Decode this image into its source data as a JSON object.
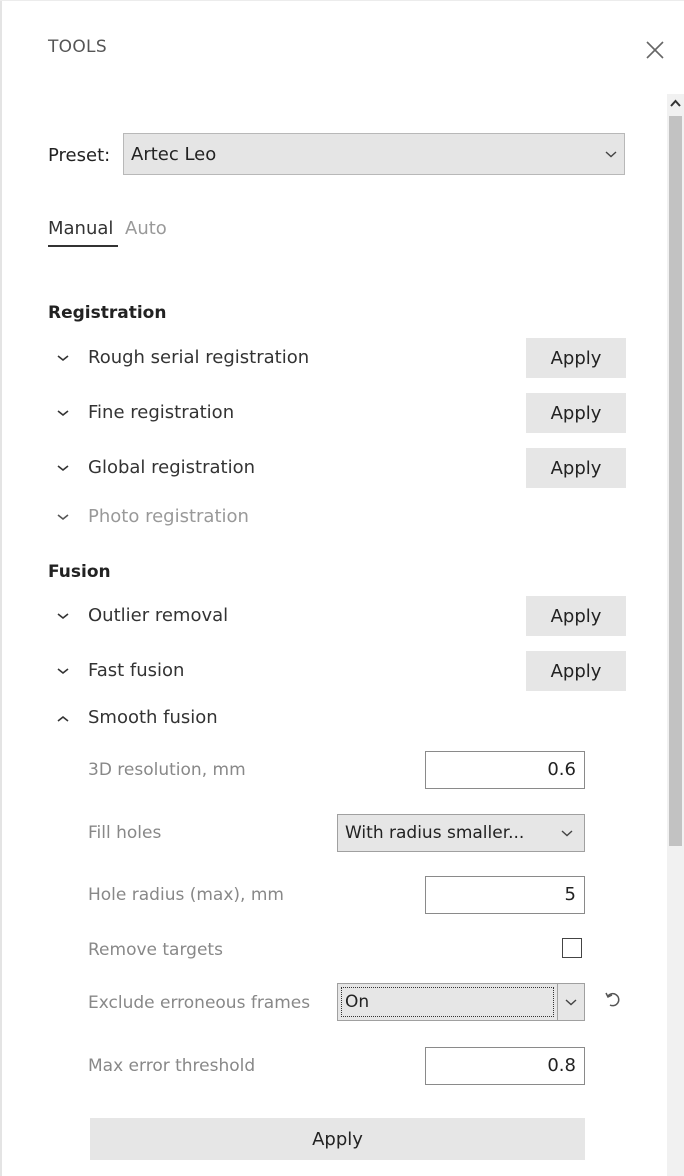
{
  "header": {
    "title": "TOOLS"
  },
  "preset": {
    "label": "Preset:",
    "value": "Artec Leo"
  },
  "tabs": [
    {
      "label": "Manual",
      "active": true
    },
    {
      "label": "Auto",
      "active": false
    }
  ],
  "registration": {
    "title": "Registration",
    "rows": [
      {
        "label": "Rough serial registration",
        "apply": "Apply"
      },
      {
        "label": "Fine registration",
        "apply": "Apply"
      },
      {
        "label": "Global registration",
        "apply": "Apply"
      },
      {
        "label": "Photo registration"
      }
    ]
  },
  "fusion": {
    "title": "Fusion",
    "rows": [
      {
        "label": "Outlier removal",
        "apply": "Apply"
      },
      {
        "label": "Fast fusion",
        "apply": "Apply"
      },
      {
        "label": "Smooth fusion",
        "expanded": true
      }
    ]
  },
  "smooth_fusion": {
    "resolution": {
      "label": "3D resolution, mm",
      "value": "0.6"
    },
    "fill_holes": {
      "label": "Fill holes",
      "value": "With radius smaller..."
    },
    "hole_radius": {
      "label": "Hole radius (max), mm",
      "value": "5"
    },
    "remove_targets": {
      "label": "Remove targets",
      "checked": false
    },
    "exclude_frames": {
      "label": "Exclude erroneous frames",
      "value": "On"
    },
    "max_error": {
      "label": "Max error threshold",
      "value": "0.8"
    },
    "apply": "Apply"
  },
  "colors": {
    "button_bg": "#e6e6e6",
    "disabled_text": "#999999",
    "scroll_thumb": "#c2c2c2"
  },
  "icons": [
    "close-icon",
    "chevron-down-icon",
    "chevron-up-icon",
    "undo-icon",
    "scroll-up-icon"
  ]
}
